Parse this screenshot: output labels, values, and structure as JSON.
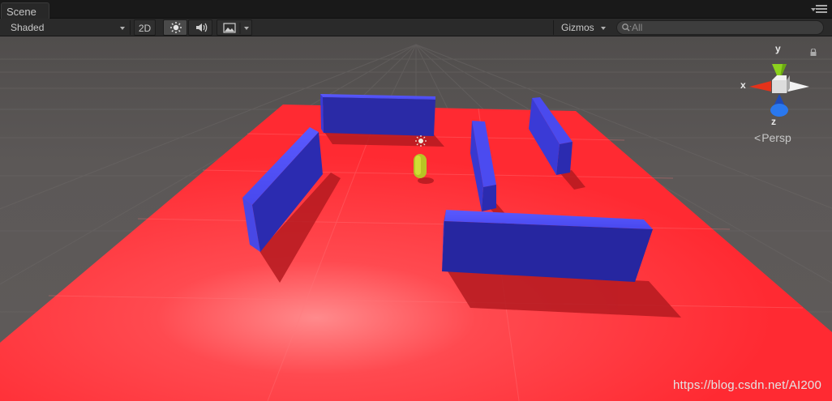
{
  "window": {
    "tab_label": "Scene"
  },
  "toolbar": {
    "shading_mode": "Shaded",
    "mode_2d_label": "2D",
    "gizmos_label": "Gizmos",
    "search_placeholder": "All"
  },
  "icons": {
    "lighting": "sun-icon",
    "audio": "speaker-icon",
    "effects": "image-icon",
    "search": "search-icon",
    "lock": "lock-icon",
    "menu": "menu-icon"
  },
  "scene_gizmo": {
    "x_label": "x",
    "y_label": "y",
    "z_label": "z",
    "projection_label": "Persp"
  },
  "colors": {
    "ground_plane": "#ff2a32",
    "walls": "#2a2aa8",
    "player": "#c6d22a",
    "background": "#5b5756",
    "axis_x": "#e4321a",
    "axis_y": "#8cd21e",
    "axis_z": "#2a6ee6"
  },
  "watermark": "https://blog.csdn.net/AI200"
}
